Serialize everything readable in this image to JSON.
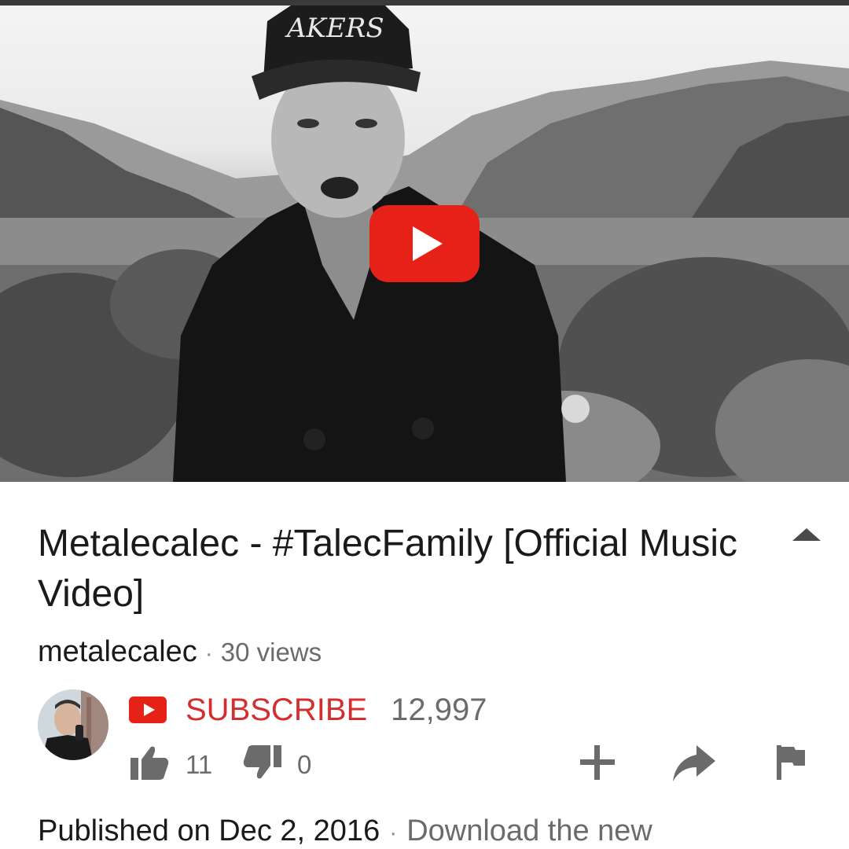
{
  "video": {
    "title": "Metalecalec - #TalecFamily [Official Music Video]",
    "channel": "metalecalec",
    "views": "30 views",
    "play_icon": "play-icon"
  },
  "subscribe": {
    "label": "SUBSCRIBE",
    "count": "12,997",
    "brand_color": "#e62117"
  },
  "actions": {
    "likes": "11",
    "dislikes": "0",
    "icons": [
      "thumbs-up-icon",
      "thumbs-down-icon",
      "add-to-playlist-icon",
      "share-icon",
      "flag-icon"
    ]
  },
  "description": {
    "published": "Published on Dec 2, 2016",
    "snippet": "Download the new"
  }
}
